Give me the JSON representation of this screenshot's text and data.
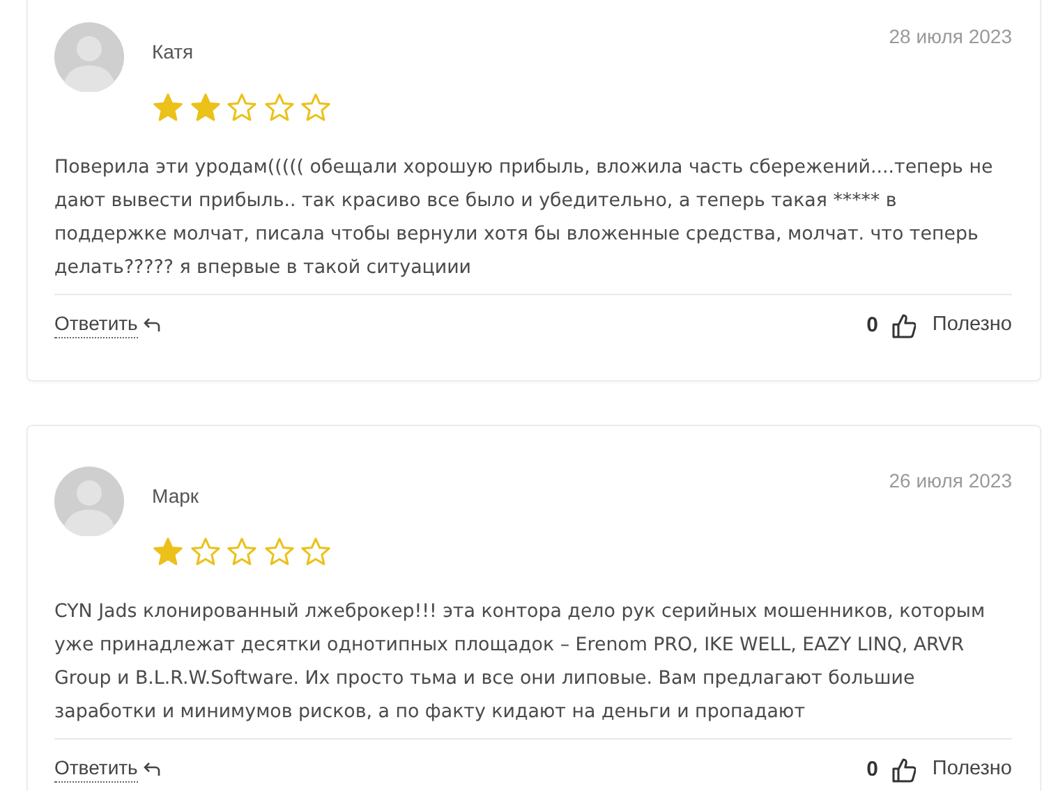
{
  "reviews": [
    {
      "author": "Катя",
      "date": "28 июля 2023",
      "stars": 2,
      "text": "Поверила эти уродам((((( обещали хорошую прибыль, вложила часть сбережений....теперь не дают вывести прибыль.. так красиво все было и убедительно, а теперь такая ***** в поддержке молчат, писала чтобы вернули хотя бы вложенные средства, молчат. что теперь делать????? я впервые в такой ситуациии",
      "reply": "Ответить",
      "likes": "0",
      "helpful": "Полезно"
    },
    {
      "author": "Марк",
      "date": "26 июля 2023",
      "stars": 1,
      "text": "CYN Jads клонированный лжеброкер!!! эта контора дело рук серийных мошенников, которым уже принадлежат десятки однотипных площадок – Erenom PRO, IKE WELL, EAZY LINQ, ARVR Group и B.L.R.W.Software. Их просто тьма и все они липовые. Вам предлагают большие заработки и минимумов рисков, а по факту кидают на деньги и пропадают",
      "reply": "Ответить",
      "likes": "0",
      "helpful": "Полезно"
    }
  ]
}
